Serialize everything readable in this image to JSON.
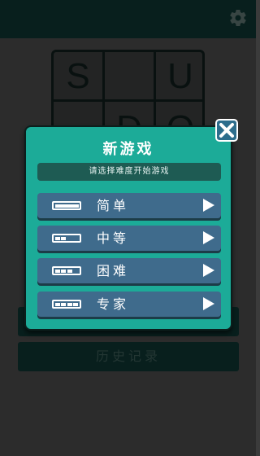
{
  "app": {
    "settings_icon": "gear-icon"
  },
  "board": {
    "letters": [
      "S",
      "U",
      "D",
      "O"
    ]
  },
  "background_buttons": {
    "history_label": "历史记录"
  },
  "dialog": {
    "title": "新游戏",
    "subtitle": "请选择难度开始游戏",
    "close_icon": "close-icon",
    "options": [
      {
        "label": "简单",
        "level": 1,
        "icon": "difficulty-bar-icon"
      },
      {
        "label": "中等",
        "level": 2,
        "icon": "difficulty-bar-icon"
      },
      {
        "label": "困难",
        "level": 3,
        "icon": "difficulty-bar-icon"
      },
      {
        "label": "专家",
        "level": 4,
        "icon": "difficulty-bar-icon"
      }
    ]
  },
  "colors": {
    "dialog_bg": "#1cab98",
    "button_bg": "#3f6b8c",
    "topbar": "#0b2a27"
  }
}
